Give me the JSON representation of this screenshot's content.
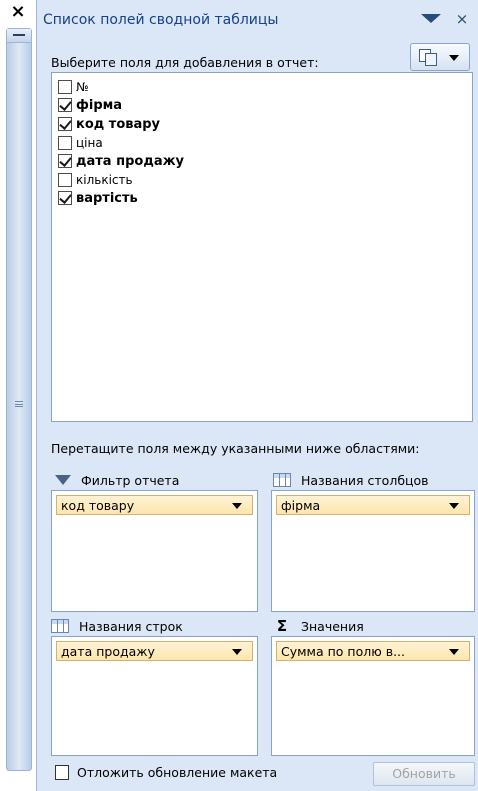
{
  "pane": {
    "title": "Список полей сводной таблицы",
    "close_symbol": "×",
    "strip_close_symbol": "×"
  },
  "field_section": {
    "label": "Выберите поля для добавления в отчет:",
    "fields": [
      {
        "label": "№",
        "checked": false,
        "bold": false
      },
      {
        "label": "фірма",
        "checked": true,
        "bold": true
      },
      {
        "label": "код товару",
        "checked": true,
        "bold": true
      },
      {
        "label": "ціна",
        "checked": false,
        "bold": false
      },
      {
        "label": "дата продажу",
        "checked": true,
        "bold": true
      },
      {
        "label": "кількість",
        "checked": false,
        "bold": false
      },
      {
        "label": "вартість",
        "checked": true,
        "bold": true
      }
    ]
  },
  "areas": {
    "hint": "Перетащите поля между указанными ниже областями:",
    "filter": {
      "header": "Фильтр отчета",
      "item": "код товару"
    },
    "columns": {
      "header": "Названия столбцов",
      "item": "фірма"
    },
    "rows": {
      "header": "Названия строк",
      "item": "дата продажу"
    },
    "values": {
      "header": "Значения",
      "item": "Сумма по полю в...",
      "icon_symbol": "Σ"
    }
  },
  "footer": {
    "defer_label": "Отложить обновление макета",
    "defer_checked": false,
    "update_label": "Обновить",
    "update_enabled": false
  },
  "icons": {
    "title_menu": "triangle-down-icon",
    "layout": "layout-sections-icon",
    "filter": "filter-funnel-icon",
    "columns": "column-grid-icon",
    "rows": "row-grid-icon",
    "values": "sigma-icon"
  },
  "colors": {
    "pane_bg": "#dbe7f6",
    "title_text": "#15428b",
    "item_fill": "#fde5ac",
    "border": "#8aa4c8",
    "disabled_text": "#a3a3a3"
  }
}
